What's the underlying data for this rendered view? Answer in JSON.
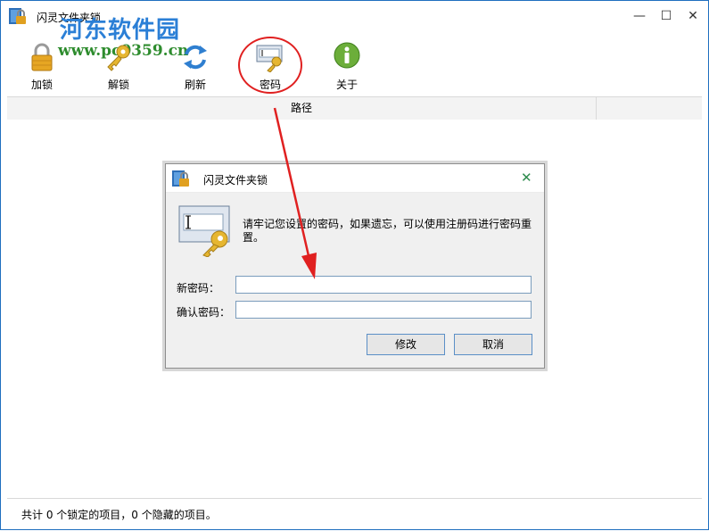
{
  "window": {
    "title": "闪灵文件夹锁"
  },
  "watermark": {
    "site_name": "河东软件园",
    "url": "www.pc0359.cn"
  },
  "toolbar": {
    "lock_label": "加锁",
    "unlock_label": "解锁",
    "refresh_label": "刷新",
    "password_label": "密码",
    "about_label": "关于"
  },
  "table": {
    "columns": [
      "路径",
      ""
    ]
  },
  "status": {
    "text": "共计 0 个锁定的项目，0 个隐藏的项目。"
  },
  "dialog": {
    "title": "闪灵文件夹锁",
    "message": "请牢记您设置的密码，如果遗忘，可以使用注册码进行密码重置。",
    "new_password_label": "新密码：",
    "new_password_value": "",
    "confirm_password_label": "确认密码：",
    "confirm_password_value": "",
    "modify_label": "修改",
    "cancel_label": "取消"
  },
  "colors": {
    "highlight": "#e02020",
    "accent": "#2b7fd6",
    "watermark_green": "#2e8c2e"
  }
}
